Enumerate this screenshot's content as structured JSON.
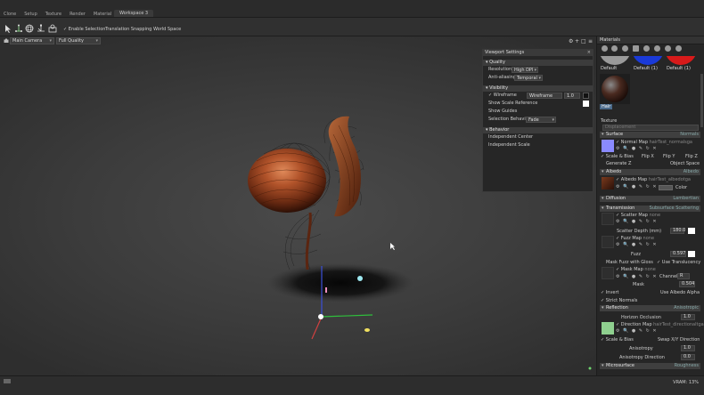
{
  "menu": {
    "items": [
      "Clone",
      "Setup",
      "Texture",
      "Render",
      "Material"
    ],
    "workspace_tab": "Workspace 3"
  },
  "toolbar": {
    "enable_selection": "✓ Enable Selection",
    "translation_snapping": "Translation Snapping",
    "world_space": "World Space"
  },
  "viewport": {
    "camera": "Main Camera",
    "quality": "Full Quality"
  },
  "viewport_settings": {
    "title": "Viewport Settings",
    "quality_header": "Quality",
    "resolution_label": "Resolution",
    "resolution_value": "High DPI",
    "antialiasing_label": "Anti-aliasing",
    "antialiasing_value": "Temporal",
    "visibility_header": "Visibility",
    "wireframe_label": "✓ Wireframe",
    "wireframe_mode": "Wireframe",
    "wireframe_value": "1.0",
    "show_scale_reference": "Show Scale Reference",
    "show_guides": "Show Guides",
    "selection_behavior_label": "Selection Behavior",
    "selection_behavior_value": "Fade",
    "behavior_header": "Behavior",
    "independent_center": "Independent Center",
    "independent_scale": "Independent Scale"
  },
  "materials": {
    "title": "Materials",
    "swatches": [
      "Default",
      "Default (1)",
      "Default (1)"
    ],
    "selected": "Hair",
    "texture_label": "Texture",
    "displacement": "Displacement",
    "surface_header": "Surface",
    "surface_value": "Normals",
    "normal_map_label": "✓ Normal Map",
    "normal_map_file": "hairTest_normalsga",
    "scale_bias": "✓ Scale & Bias",
    "flip_x": "Flip X",
    "flip_y": "Flip Y",
    "flip_z": "Flip Z",
    "generate_z": "Generate Z",
    "object_space": "Object Space",
    "albedo_header": "Albedo",
    "albedo_value": "Albedo",
    "albedo_map_label": "✓ Albedo Map",
    "albedo_map_file": "hairTest_albedotga",
    "color_label": "Color",
    "diffusion_header": "Diffusion",
    "diffusion_value": "Lambertian",
    "transmission_header": "Transmission",
    "transmission_value": "Subsurface Scattering",
    "scatter_map_label": "✓ Scatter Map",
    "scatter_map_file": "none",
    "scatter_depth_label": "Scatter Depth (mm)",
    "scatter_depth_value": "180.0",
    "fuzz_map_label": "✓ Fuzz Map",
    "fuzz_map_file": "none",
    "fuzz_label": "Fuzz",
    "fuzz_value": "0.597",
    "mask_fuzz_gloss": "Mask Fuzz with Gloss",
    "use_translucency": "✓ Use Translucency",
    "mask_map_label": "✓ Mask Map",
    "mask_map_file": "none",
    "channel_label": "Channel",
    "channel_value": "R",
    "mask_label": "Mask",
    "mask_value": "0.504",
    "invert": "✓ Invert",
    "use_albedo_alpha": "Use Albedo Alpha",
    "strict_normals": "✓ Strict Normals",
    "reflection_header": "Reflection",
    "reflection_value": "Anisotropic",
    "horizon_occlusion_label": "Horizon Occlusion",
    "horizon_occlusion_value": "1.0",
    "direction_map_label": "✓ Direction Map",
    "direction_map_file": "hairTest_directionaltga",
    "scale_bias_2": "✓ Scale & Bias",
    "swap_xy": "Swap X/Y Direction",
    "anisotropy_label": "Anisotropy",
    "anisotropy_value": "1.0",
    "anisotropy_dir_label": "Anisotropy Direction",
    "anisotropy_dir_value": "0.0",
    "microsurface_header": "Microsurface",
    "microsurface_value": "Roughness"
  },
  "status": {
    "right": "VRAM: 13%"
  },
  "colors": {
    "accent": "#4a6a8a",
    "hair_base": "#7a3a1e",
    "normal_map": "#8a8aff",
    "direction_map": "#8fd08f"
  }
}
